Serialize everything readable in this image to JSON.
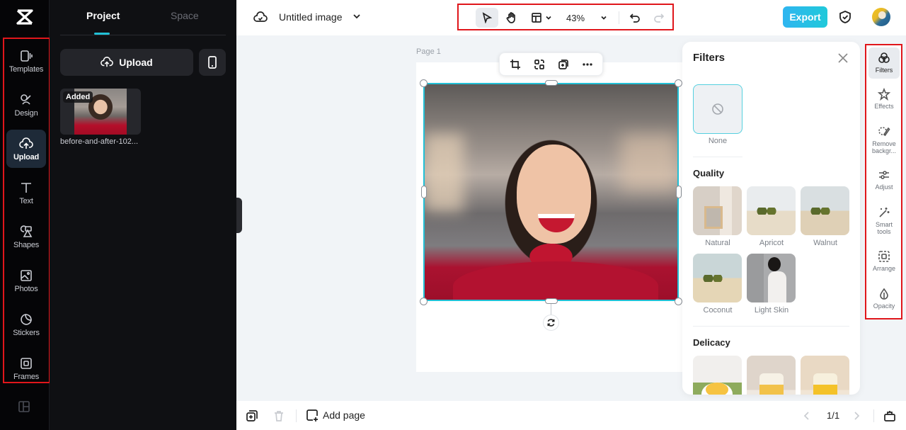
{
  "app": {
    "brand": "CapCut"
  },
  "left_rail": {
    "items": [
      {
        "label": "Templates",
        "icon": "templates-icon",
        "active": false
      },
      {
        "label": "Design",
        "icon": "design-icon",
        "active": false
      },
      {
        "label": "Upload",
        "icon": "upload-cloud-icon",
        "active": true
      },
      {
        "label": "Text",
        "icon": "text-icon",
        "active": false
      },
      {
        "label": "Shapes",
        "icon": "shapes-icon",
        "active": false
      },
      {
        "label": "Photos",
        "icon": "photos-icon",
        "active": false
      },
      {
        "label": "Stickers",
        "icon": "stickers-icon",
        "active": false
      },
      {
        "label": "Frames",
        "icon": "frames-icon",
        "active": false
      }
    ],
    "bottom_icon": "layout-panel-icon"
  },
  "side_panel": {
    "tabs": [
      {
        "label": "Project",
        "active": true
      },
      {
        "label": "Space",
        "active": false
      }
    ],
    "upload_label": "Upload",
    "media": [
      {
        "badge": "Added",
        "name": "before-and-after-102..."
      }
    ]
  },
  "topbar": {
    "title": "Untitled image",
    "zoom": "43%",
    "export_label": "Export",
    "tools": [
      "select-pointer",
      "hand-pan",
      "layout",
      "zoom",
      "undo",
      "redo"
    ]
  },
  "canvas": {
    "page_label": "Page 1",
    "context_toolbar": [
      "crop",
      "replace",
      "duplicate",
      "more"
    ]
  },
  "filters_panel": {
    "title": "Filters",
    "none_label": "None",
    "sections": [
      {
        "title": "Quality",
        "items": [
          "Natural",
          "Apricot",
          "Walnut",
          "Coconut",
          "Light Skin"
        ]
      },
      {
        "title": "Delicacy",
        "items": [
          "",
          "",
          ""
        ]
      }
    ]
  },
  "right_rail": {
    "items": [
      {
        "label": "Filters",
        "active": true
      },
      {
        "label": "Effects",
        "active": false
      },
      {
        "label": "Remove backgr...",
        "active": false
      },
      {
        "label": "Adjust",
        "active": false
      },
      {
        "label": "Smart tools",
        "active": false
      },
      {
        "label": "Arrange",
        "active": false
      },
      {
        "label": "Opacity",
        "active": false
      }
    ]
  },
  "bottombar": {
    "add_page_label": "Add page",
    "pager": "1/1"
  },
  "colors": {
    "accent": "#22c0d6",
    "export_gradient_start": "#2fb5f0",
    "export_gradient_end": "#20c9da",
    "highlight_box": "#e0161b"
  }
}
